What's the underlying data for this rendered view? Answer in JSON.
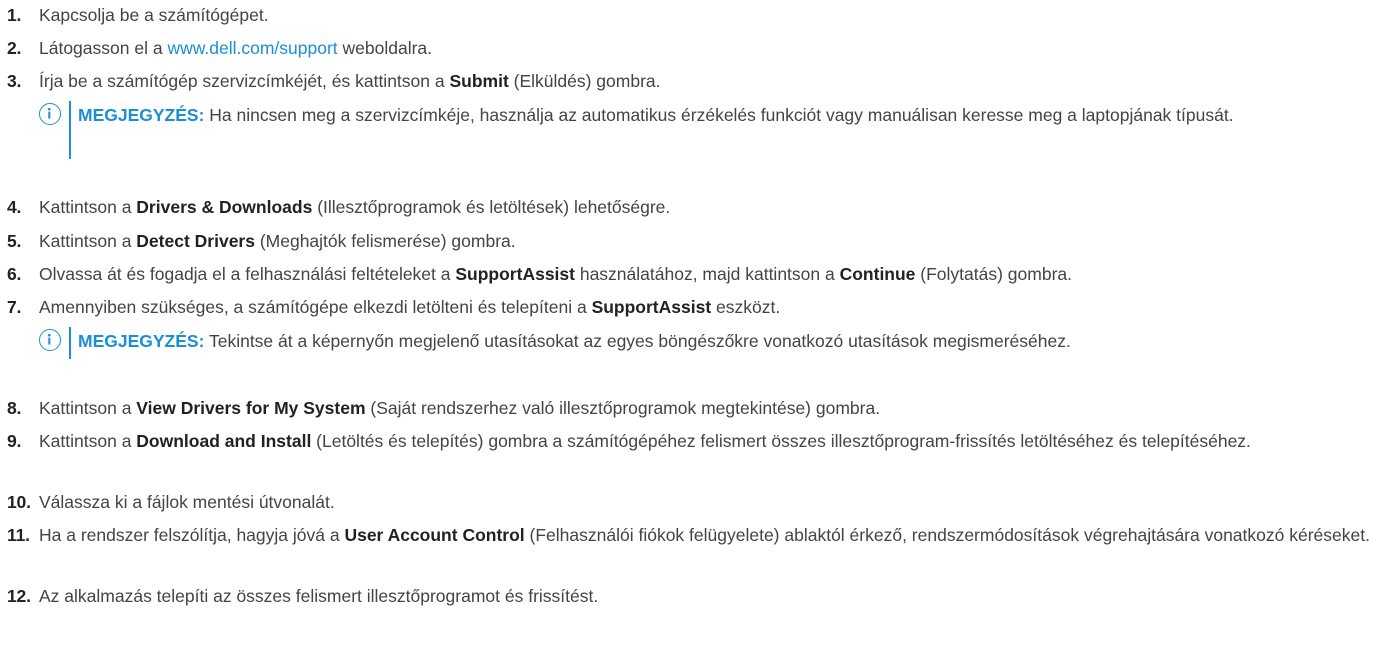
{
  "steps": [
    {
      "num": "1.",
      "parts": [
        {
          "t": "Kapcsolja be a számítógépet."
        }
      ]
    },
    {
      "num": "2.",
      "parts": [
        {
          "t": "Látogasson el a "
        },
        {
          "t": "www.dell.com/support",
          "link": true
        },
        {
          "t": " weboldalra."
        }
      ]
    },
    {
      "num": "3.",
      "parts": [
        {
          "t": "Írja be a számítógép szervizcímkéjét, és kattintson a "
        },
        {
          "t": "Submit",
          "b": true
        },
        {
          "t": " (Elküldés) gombra."
        }
      ]
    },
    {
      "num": "4.",
      "parts": [
        {
          "t": "Kattintson a "
        },
        {
          "t": "Drivers & Downloads",
          "b": true
        },
        {
          "t": " (Illesztőprogramok és letöltések) lehetőségre."
        }
      ]
    },
    {
      "num": "5.",
      "parts": [
        {
          "t": "Kattintson a "
        },
        {
          "t": "Detect Drivers",
          "b": true
        },
        {
          "t": " (Meghajtók felismerése) gombra."
        }
      ]
    },
    {
      "num": "6.",
      "parts": [
        {
          "t": "Olvassa át és fogadja el a felhasználási feltételeket a "
        },
        {
          "t": "SupportAssist",
          "b": true
        },
        {
          "t": " használatához, majd kattintson a "
        },
        {
          "t": "Continue",
          "b": true
        },
        {
          "t": " (Folytatás) gombra."
        }
      ]
    },
    {
      "num": "7.",
      "parts": [
        {
          "t": "Amennyiben szükséges, a számítógépe elkezdi letölteni és telepíteni a "
        },
        {
          "t": "SupportAssist",
          "b": true
        },
        {
          "t": " eszközt."
        }
      ]
    },
    {
      "num": "8.",
      "parts": [
        {
          "t": "Kattintson a "
        },
        {
          "t": "View Drivers for My System",
          "b": true
        },
        {
          "t": " (Saját rendszerhez való illesztőprogramok megtekintése) gombra."
        }
      ]
    },
    {
      "num": "9.",
      "parts": [
        {
          "t": "Kattintson a "
        },
        {
          "t": "Download and Install",
          "b": true
        },
        {
          "t": " (Letöltés és telepítés) gombra a számítógépéhez felismert összes illesztőprogram-frissítés letöltéséhez és telepítéséhez."
        }
      ]
    },
    {
      "num": "10.",
      "parts": [
        {
          "t": "Válassza ki a fájlok mentési útvonalát."
        }
      ]
    },
    {
      "num": "11.",
      "parts": [
        {
          "t": "Ha a rendszer felszólítja, hagyja jóvá a "
        },
        {
          "t": "User Account Control",
          "b": true
        },
        {
          "t": " (Felhasználói fiókok felügyelete) ablaktól érkező, rendszermódosítások végrehajtására vonatkozó kéréseket."
        }
      ]
    },
    {
      "num": "12.",
      "parts": [
        {
          "t": "Az alkalmazás telepíti az összes felismert illesztőprogramot és frissítést."
        }
      ]
    }
  ],
  "notes": [
    {
      "label": "MEGJEGYZÉS:",
      "text": " Ha nincsen meg a szervizcímkéje, használja az automatikus érzékelés funkciót vagy manuálisan keresse meg a laptopjának típusát."
    },
    {
      "label": "MEGJEGYZÉS:",
      "text": " Tekintse át a képernyőn megjelenő utasításokat az egyes böngészőkre vonatkozó utasítások megismeréséhez."
    }
  ],
  "icons": {
    "note_icon": "info-icon"
  },
  "colors": {
    "link": "#1a8fd6",
    "note_label": "#1a8fd6",
    "text": "#444444",
    "bold": "#222222"
  }
}
